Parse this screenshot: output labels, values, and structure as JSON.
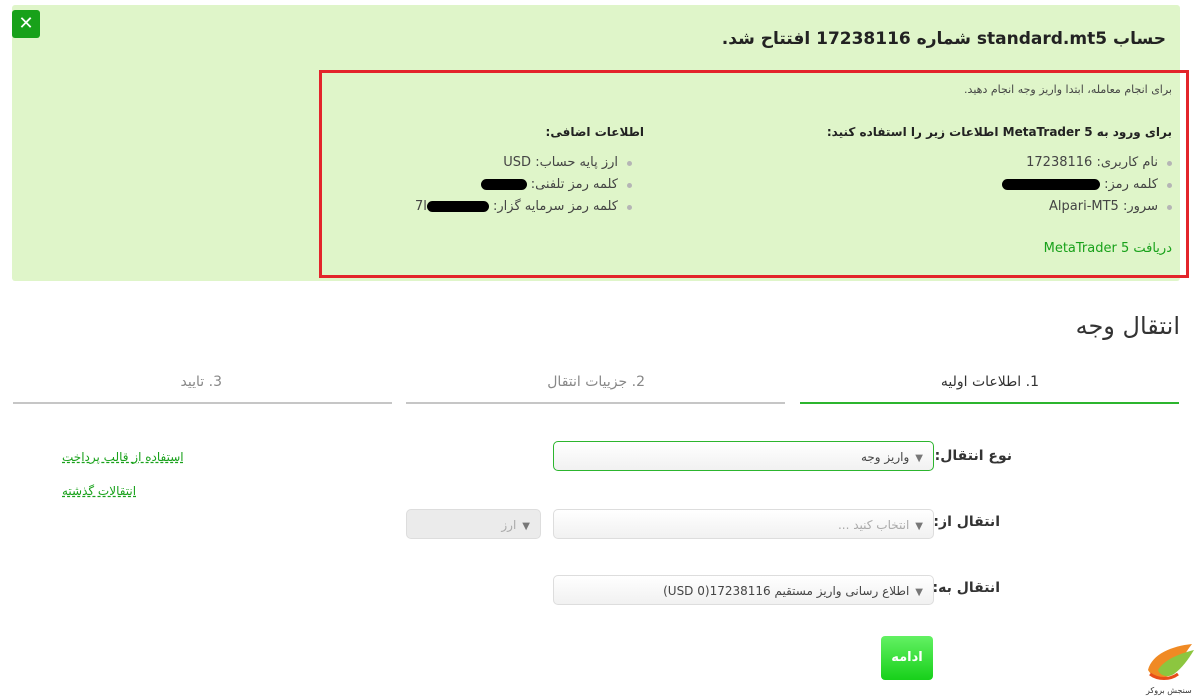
{
  "panel": {
    "close_icon": "close-icon",
    "title": "حساب standard.mt5 شماره 17238116 افتتاح شد.",
    "hint": "برای انجام معامله، ابتدا واریز وجه انجام دهید.",
    "login_heading": "برای ورود به MetaTrader 5 اطلاعات زیر را استفاده کنید:",
    "login": {
      "username_label": "نام کاربری:",
      "username_value": "17238116",
      "password_label": "کلمه رمز:",
      "server_label": "سرور:",
      "server_value": "Alpari-MT5"
    },
    "extra_heading": "اطلاعات اضافی:",
    "extra": {
      "currency_label": "ارز پایه حساب:",
      "currency_value": "USD",
      "phone_password_label": "کلمه رمز تلفنی:",
      "investor_password_label": "کلمه رمز سرمایه گزار:",
      "investor_password_prefix": "7l"
    },
    "download_link": "دریافت MetaTrader 5"
  },
  "transfer": {
    "title": "انتقال وجه",
    "steps": [
      {
        "label": "1. اطلاعات اولیه",
        "active": true
      },
      {
        "label": "2. جزییات انتقال",
        "active": false
      },
      {
        "label": "3. تایید",
        "active": false
      }
    ],
    "type_label": "نوع انتقال:",
    "type_value": "واریز وجه",
    "from_label": "انتقال از:",
    "from_placeholder": "انتخاب کنید ...",
    "currency_placeholder": "ارز",
    "to_label": "انتقال به:",
    "to_value": "اطلاع رسانی واریز مستقیم 17238116(0 USD)",
    "links": {
      "template": "استفاده از قالب پرداخت",
      "history": "انتقالات گذشته"
    },
    "continue_label": "ادامه"
  },
  "logo_text": "سنجش بروکر",
  "colors": {
    "accent": "#18a11a",
    "panel_bg": "#dff5c9",
    "highlight": "#e3242b"
  }
}
